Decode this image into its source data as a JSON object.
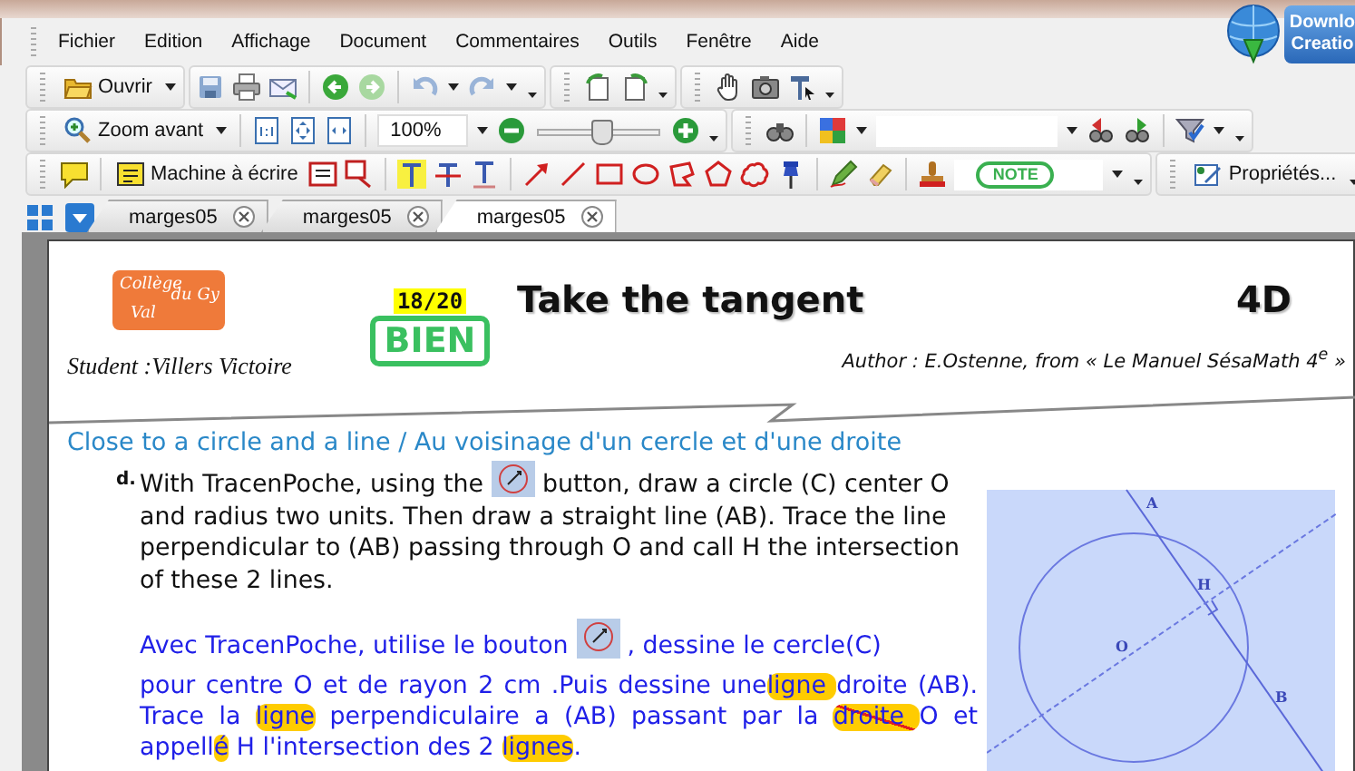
{
  "menu": [
    "Fichier",
    "Edition",
    "Affichage",
    "Document",
    "Commentaires",
    "Outils",
    "Fenêtre",
    "Aide"
  ],
  "download_button": [
    "Downlo",
    "Creatio"
  ],
  "toolbar": {
    "open_button": "Ouvrir",
    "zoom_button": "Zoom avant",
    "zoom_field": "100%",
    "zoom_slider": {
      "level": 0.5
    },
    "typewriter_button": "Machine à écrire",
    "note_stamp": "NOTE",
    "properties_button": "Propriétés..."
  },
  "tabs": [
    {
      "label": "marges05",
      "selected": false
    },
    {
      "label": "marges05",
      "selected": false
    },
    {
      "label": "marges05",
      "selected": true
    }
  ],
  "document": {
    "logo": [
      "Collège",
      "du Gy",
      "Val"
    ],
    "score": "18/20",
    "stamp": "BIEN",
    "title": "Take the tangent",
    "class": "4D",
    "student": "Student :Villers Victoire",
    "author": "Author :  E.Ostenne, from « Le Manuel SésaMath 4$^{e}$ »",
    "section_heading": "Close to a circle and a line / Au voisinage d'un cercle et d'une droite",
    "exercise_label": "d.",
    "english_text": {
      "before": "With TracenPoche, using the",
      "after": "button, draw a circle (C) center O and radius two units. Then draw a straight line (AB). Trace the line perpendicular to (AB) passing through O and call H the intersection of these 2 lines."
    },
    "french_intro": {
      "before": "Avec TracenPoche, utilise le bouton",
      "after": ", dessine le cercle(C)"
    },
    "french_paragraph": [
      {
        "text": "pour centre O et de rayon 2 cm .Puis dessine une",
        "kind": "plain"
      },
      {
        "text": "ligne ",
        "kind": "highlight"
      },
      {
        "text": "droite (AB). Trace la ",
        "kind": "plain"
      },
      {
        "text": "ligne",
        "kind": "highlight"
      },
      {
        "text": " perpendiculaire a (AB) passant par la ",
        "kind": "plain"
      },
      {
        "text": "droite ",
        "kind": "struck_highlight"
      },
      {
        "text": "O et appell",
        "kind": "plain"
      },
      {
        "text": "é",
        "kind": "highlight"
      },
      {
        "text": " H l'intersection des 2 ",
        "kind": "plain"
      },
      {
        "text": "lignes",
        "kind": "highlight"
      },
      {
        "text": ".",
        "kind": "plain"
      }
    ],
    "figure_labels": [
      "A",
      "H",
      "O",
      "B"
    ]
  }
}
